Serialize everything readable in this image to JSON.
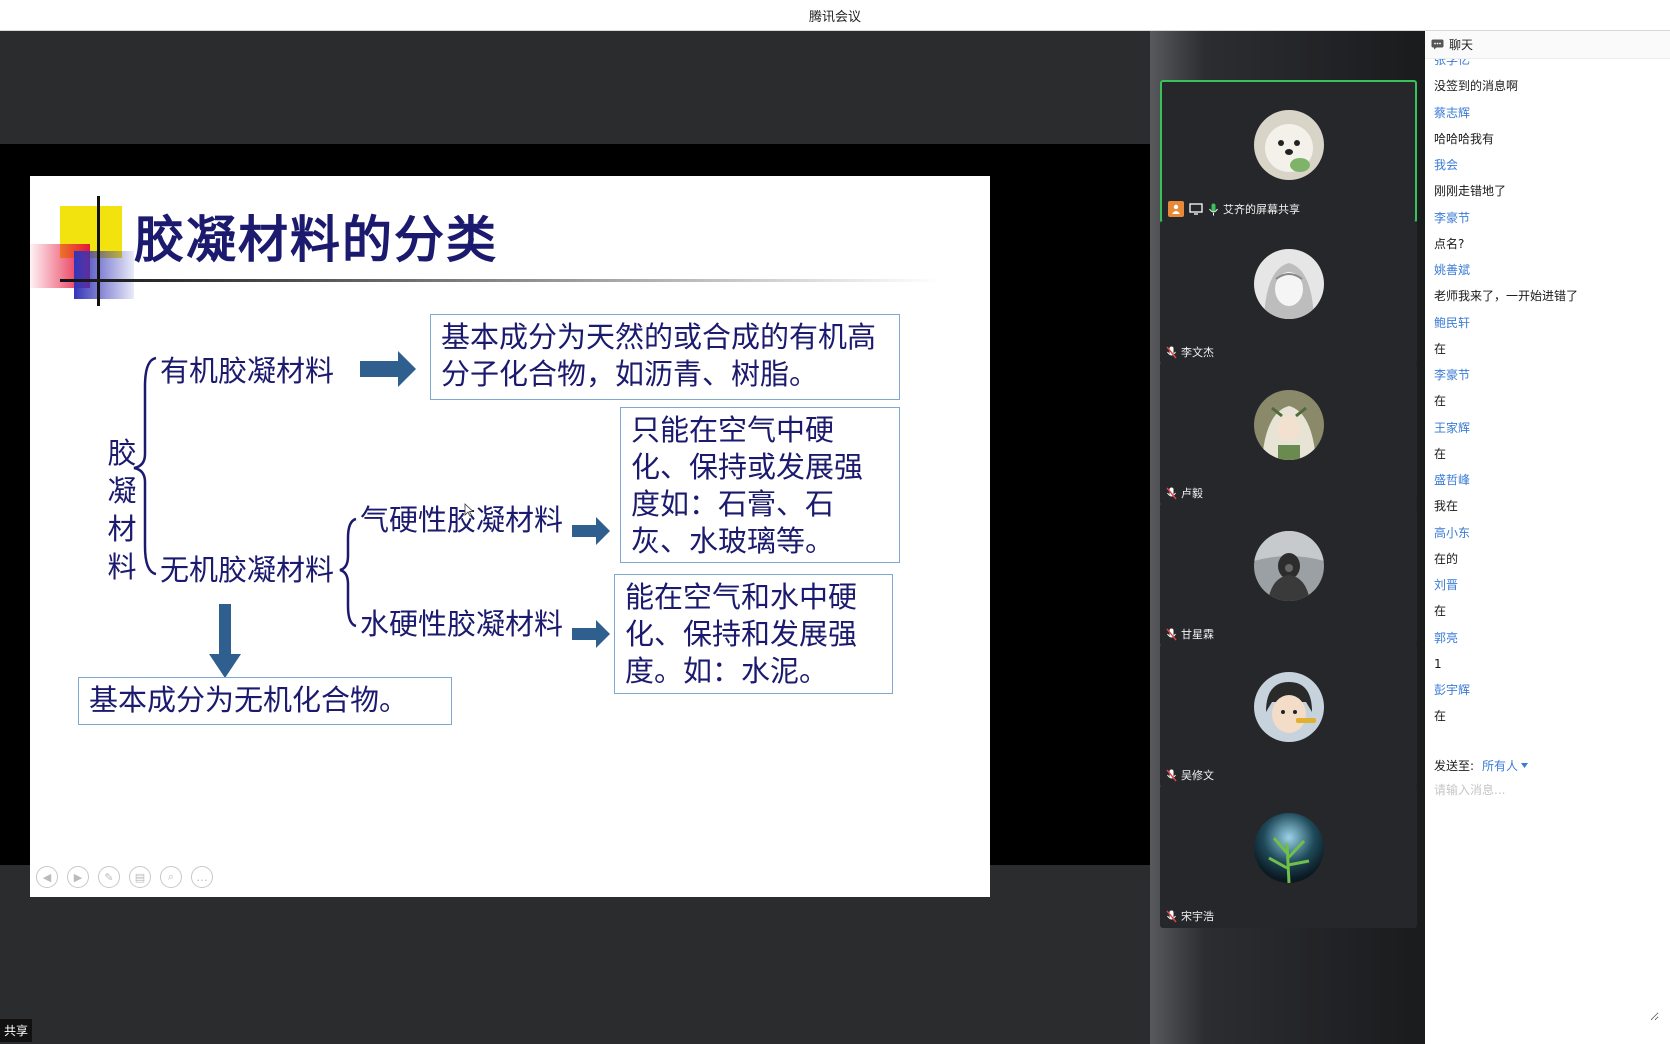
{
  "window": {
    "title": "腾讯会议"
  },
  "slide": {
    "title": "胶凝材料的分类",
    "root_label": "胶凝材料",
    "organic_label": "有机胶凝材料",
    "inorganic_label": "无机胶凝材料",
    "air_label": "气硬性胶凝材料",
    "hydraulic_label": "水硬性胶凝材料",
    "organic_desc": "基本成分为天然的或合成的有机高分子化合物，如沥青、树脂。",
    "air_desc": "只能在空气中硬化、保持或发展强度如：石膏、石灰、水玻璃等。",
    "hydraulic_desc": "能在空气和水中硬化、保持和发展强度。如：水泥。",
    "inorganic_desc": "基本成分为无机化合物。",
    "text_color": "#1b1a6e",
    "arrow_color": "#2e5f8f"
  },
  "share_tag": "共享",
  "participants": [
    {
      "name": "艾齐的屏幕共享",
      "avatar": "white-dog-avatar",
      "active": true
    },
    {
      "name": "李文杰",
      "avatar": "anime-girl-avatar",
      "active": false
    },
    {
      "name": "卢毅",
      "avatar": "anime-character-avatar",
      "active": false
    },
    {
      "name": "甘星霖",
      "avatar": "masked-person-avatar",
      "active": false
    },
    {
      "name": "吴修文",
      "avatar": "cartoon-boy-avatar",
      "active": false
    },
    {
      "name": "宋宇浩",
      "avatar": "night-plant-avatar",
      "active": false
    }
  ],
  "chat": {
    "header": "聊天",
    "messages": [
      {
        "sender": "张学亿",
        "text": "没签到的消息啊"
      },
      {
        "sender": "蔡志辉",
        "text": "哈哈哈我有"
      },
      {
        "sender": "我会",
        "text": "刚刚走错地了"
      },
      {
        "sender": "李豪节",
        "text": "点名?"
      },
      {
        "sender": "姚善斌",
        "text": "老师我来了，一开始进错了"
      },
      {
        "sender": "鲍民轩",
        "text": "在"
      },
      {
        "sender": "李豪节",
        "text": "在"
      },
      {
        "sender": "王家辉",
        "text": "在"
      },
      {
        "sender": "盛哲峰",
        "text": "我在"
      },
      {
        "sender": "高小东",
        "text": "在的"
      },
      {
        "sender": "刘晋",
        "text": "在"
      },
      {
        "sender": "郭亮",
        "text": "1"
      },
      {
        "sender": "彭宇辉",
        "text": "在"
      }
    ],
    "send_to_label": "发送至:",
    "send_to_value": "所有人",
    "input_placeholder": "请输入消息...",
    "accent": "#3a7bd5"
  },
  "active_border": "#38c25a"
}
